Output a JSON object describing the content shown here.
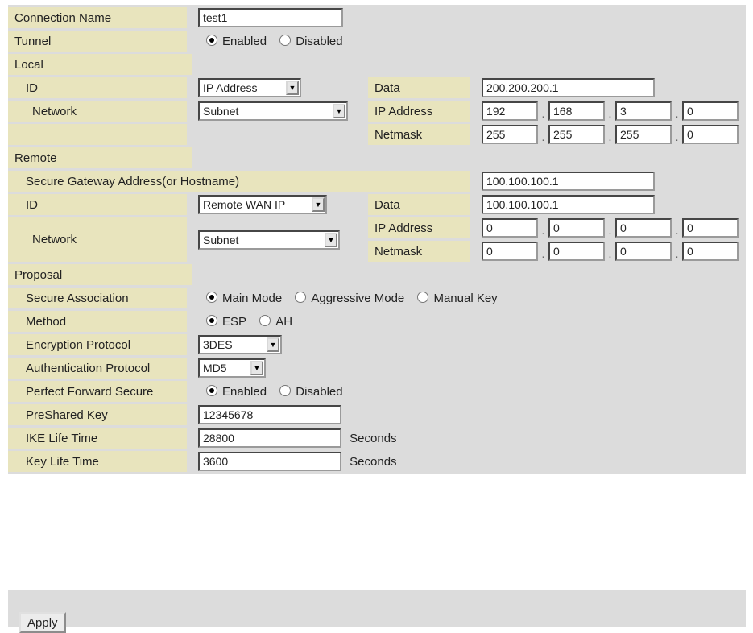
{
  "connection": {
    "label": "Connection Name",
    "value": "test1"
  },
  "tunnel": {
    "label": "Tunnel",
    "enabled": "Enabled",
    "disabled": "Disabled"
  },
  "local": {
    "section": "Local",
    "id_label": "ID",
    "id_value": "IP Address",
    "data_label": "Data",
    "data_value": "200.200.200.1",
    "network_label": "Network",
    "network_value": "Subnet",
    "ip_label": "IP Address",
    "ip": [
      "192",
      "168",
      "3",
      "0"
    ],
    "mask_label": "Netmask",
    "mask": [
      "255",
      "255",
      "255",
      "0"
    ]
  },
  "remote": {
    "section": "Remote",
    "gateway_label": "Secure Gateway Address(or Hostname)",
    "gateway_value": "100.100.100.1",
    "id_label": "ID",
    "id_value": "Remote WAN IP",
    "data_label": "Data",
    "data_value": "100.100.100.1",
    "network_label": "Network",
    "network_value": "Subnet",
    "ip_label": "IP Address",
    "ip": [
      "0",
      "0",
      "0",
      "0"
    ],
    "mask_label": "Netmask",
    "mask": [
      "0",
      "0",
      "0",
      "0"
    ]
  },
  "proposal": {
    "section": "Proposal",
    "sa_label": "Secure Association",
    "sa_main": "Main Mode",
    "sa_aggr": "Aggressive Mode",
    "sa_manual": "Manual Key",
    "method_label": "Method",
    "method_esp": "ESP",
    "method_ah": "AH",
    "enc_label": "Encryption Protocol",
    "enc_value": "3DES",
    "auth_label": "Authentication Protocol",
    "auth_value": "MD5",
    "pfs_label": "Perfect Forward Secure",
    "pfs_enabled": "Enabled",
    "pfs_disabled": "Disabled",
    "psk_label": "PreShared Key",
    "psk_value": "12345678",
    "ike_label": "IKE Life Time",
    "ike_value": "28800",
    "key_label": "Key Life Time",
    "key_value": "3600",
    "seconds": "Seconds"
  },
  "apply_label": "Apply",
  "icons": {
    "dropdown": "chevron-down-icon"
  }
}
